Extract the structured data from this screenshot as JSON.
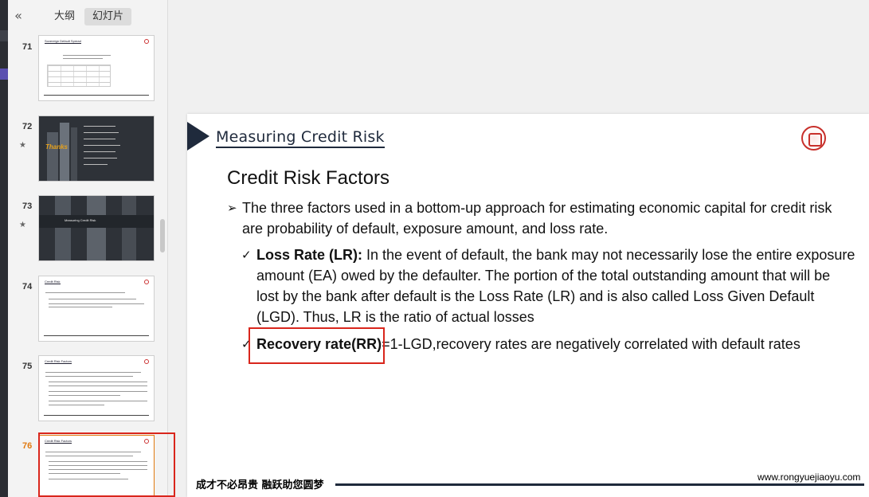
{
  "panel": {
    "collapse_icon": "double-chevron-left-icon",
    "tabs": [
      {
        "label": "大纲",
        "active": false
      },
      {
        "label": "幻灯片",
        "active": true
      }
    ],
    "thumbnails": [
      {
        "number": "71",
        "title": "Sovereign Default Spread",
        "style": "table",
        "starred": false,
        "selected": false
      },
      {
        "number": "72",
        "title": "Thanks",
        "style": "dark-thanks",
        "starred": true,
        "selected": false
      },
      {
        "number": "73",
        "title": "Measuring Credit Risk",
        "style": "dark-banner",
        "starred": true,
        "selected": false
      },
      {
        "number": "74",
        "title": "Credit Risk",
        "style": "text",
        "starred": false,
        "selected": false
      },
      {
        "number": "75",
        "title": "Credit Risk Factors",
        "style": "text",
        "starred": false,
        "selected": false
      },
      {
        "number": "76",
        "title": "Credit Risk Factors",
        "style": "text",
        "starred": false,
        "selected": true
      }
    ],
    "selected_color": "#d9261c"
  },
  "slide": {
    "header": "Measuring Credit Risk",
    "title": "Credit Risk Factors",
    "bullet": "The three factors used in a bottom-up approach for estimating economic capital for credit risk are probability of default, exposure amount, and loss rate.",
    "checks": [
      {
        "bold": "Loss Rate (LR):",
        "text": " In the event of default, the bank may not necessarily lose the entire exposure amount (EA) owed by the defaulter. The portion of the total outstanding amount that will be lost by the bank after default is the Loss Rate (LR) and is also called Loss Given Default (LGD). Thus, LR is the ratio of actual losses"
      },
      {
        "bold": "Recovery rate(RR)",
        "text": "=1-LGD,recovery rates are negatively correlated with default rates"
      }
    ],
    "footer_slogan": "成才不必昂贵 融跃助您圆梦",
    "footer_url": "www.rongyuejiaoyu.com",
    "accent_color": "#1f2a3c",
    "highlight_color": "#d9261c"
  }
}
